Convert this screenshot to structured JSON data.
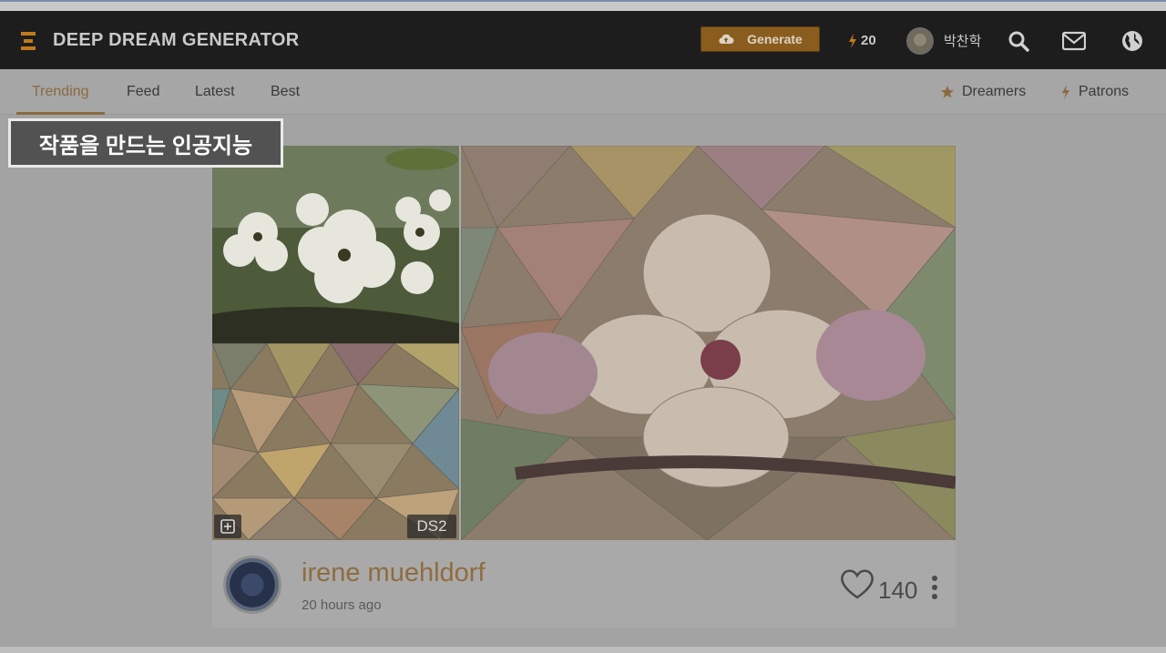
{
  "header": {
    "brand": "DEEP DREAM GENERATOR",
    "generate_label": "Generate",
    "credits": "20",
    "username": "박찬학",
    "accent": "#8a5d1e"
  },
  "subnav": {
    "tabs": [
      {
        "label": "Trending",
        "active": true
      },
      {
        "label": "Feed",
        "active": false
      },
      {
        "label": "Latest",
        "active": false
      },
      {
        "label": "Best",
        "active": false
      }
    ],
    "right": [
      {
        "label": "Dreamers",
        "icon": "star-icon"
      },
      {
        "label": "Patrons",
        "icon": "bolt-icon"
      }
    ]
  },
  "overlay": {
    "caption": "작품을 만드는 인공지능"
  },
  "post": {
    "model": "DS2",
    "author": "irene muehldorf",
    "time": "20 hours ago",
    "likes": "140"
  }
}
